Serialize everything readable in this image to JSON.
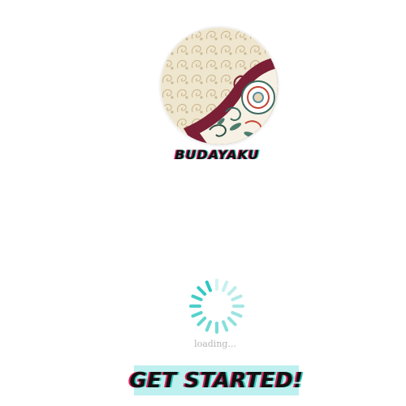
{
  "app": {
    "name": "BUDAYAKU",
    "logo_icon": "batik-floral-logo-icon"
  },
  "loader": {
    "icon": "spinner-icon",
    "text": "loading...",
    "color": "#2cc7c0"
  },
  "cta": {
    "label": "GET STARTED!",
    "background": "#bdf0ee"
  },
  "colors": {
    "accent_red": "#e0205a",
    "accent_teal": "#2cc7c0",
    "maroon": "#7a1f35",
    "beige": "#e8dcc0"
  }
}
